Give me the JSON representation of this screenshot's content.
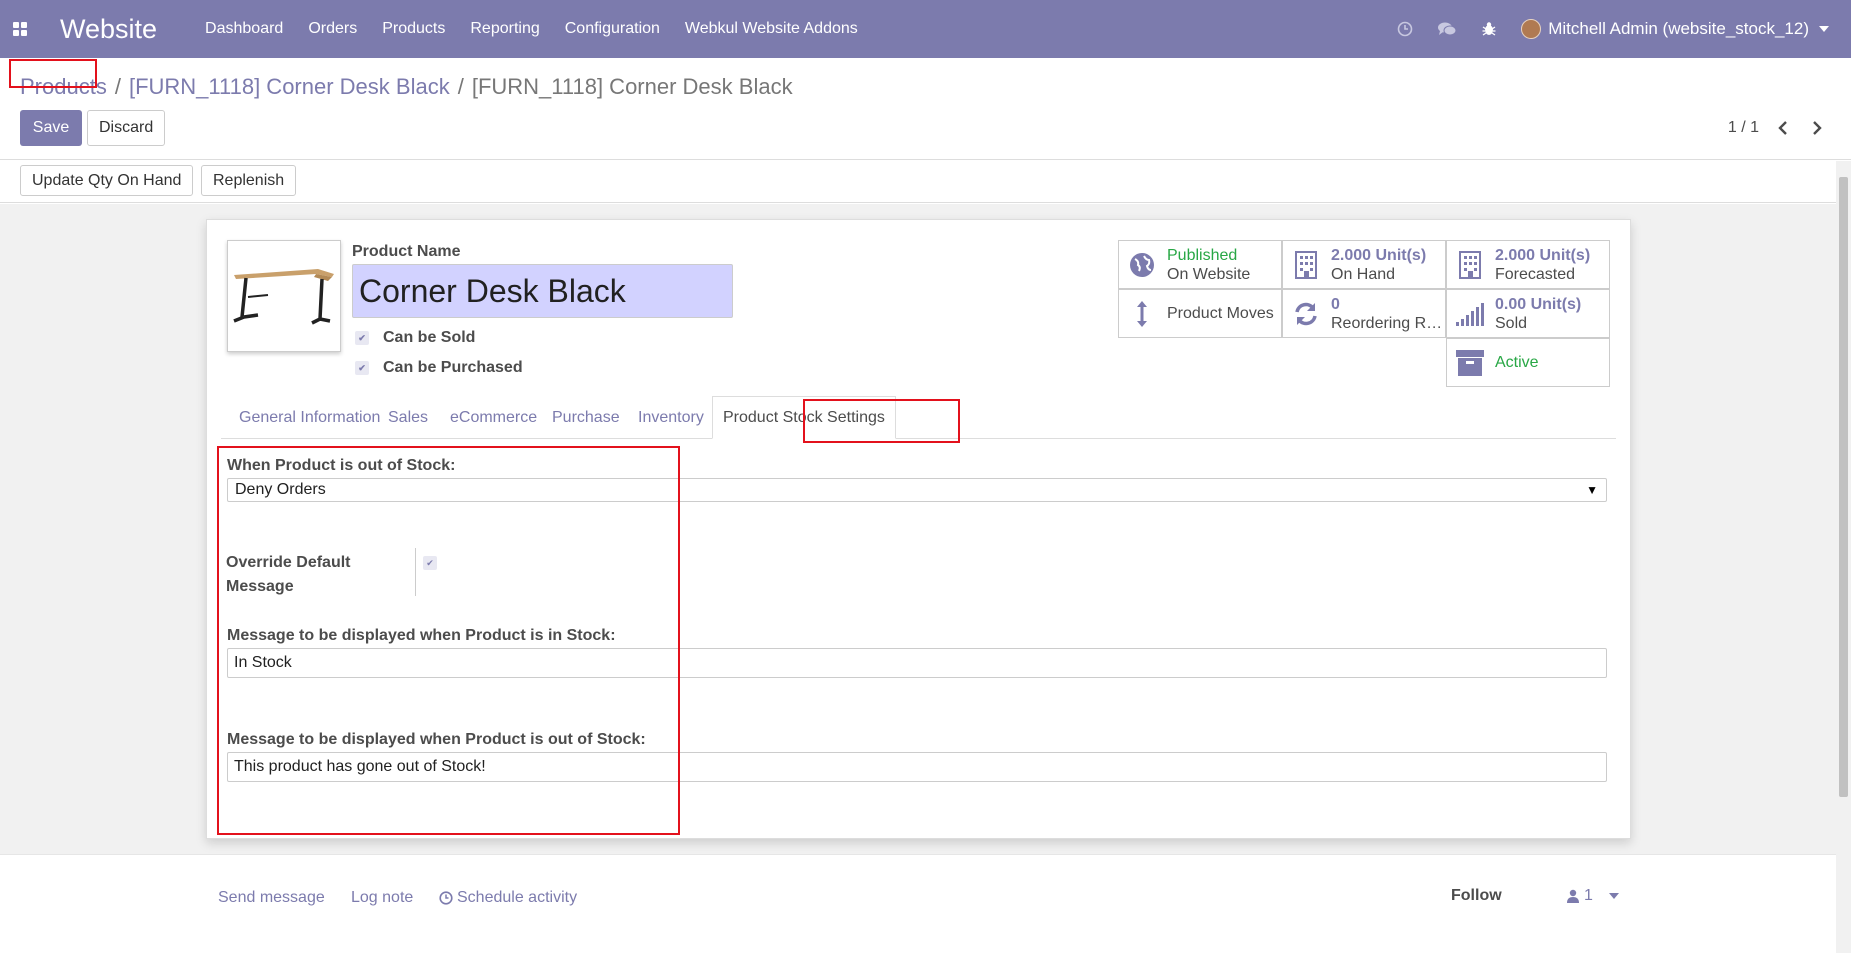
{
  "navbar": {
    "brand": "Website",
    "menu": [
      "Dashboard",
      "Orders",
      "Products",
      "Reporting",
      "Configuration",
      "Webkul Website Addons"
    ],
    "icons": [
      "clock-icon",
      "chat-icon",
      "bug-icon"
    ],
    "user": "Mitchell Admin (website_stock_12)",
    "bg_color": "#7c7bad"
  },
  "control_panel": {
    "breadcrumb": [
      "Products",
      "[FURN_1118] Corner Desk Black",
      "[FURN_1118] Corner Desk Black"
    ],
    "save_label": "Save",
    "discard_label": "Discard",
    "pager": "1 / 1"
  },
  "statusbar": {
    "update_qty_label": "Update Qty On Hand",
    "replenish_label": "Replenish"
  },
  "product": {
    "name_label": "Product Name",
    "name": "Corner Desk Black",
    "can_be_sold_label": "Can be Sold",
    "can_be_sold": true,
    "can_be_purchased_label": "Can be Purchased",
    "can_be_purchased": true
  },
  "smart_buttons": {
    "published": {
      "value": "Published",
      "sub": "On Website",
      "icon": "globe-icon"
    },
    "on_hand": {
      "value": "2.000 Unit(s)",
      "sub": "On Hand",
      "icon": "building-icon"
    },
    "forecasted": {
      "value": "2.000 Unit(s)",
      "sub": "Forecasted",
      "icon": "building-icon"
    },
    "product_moves": {
      "label": "Product Moves",
      "icon": "up-down-arrow-icon"
    },
    "reordering": {
      "value": "0",
      "sub": "Reordering Rules",
      "icon": "refresh-icon"
    },
    "sold": {
      "value": "0.00 Unit(s)",
      "sub": "Sold",
      "icon": "signal-icon"
    },
    "active": {
      "label": "Active",
      "icon": "archive-icon"
    }
  },
  "tabs": [
    "General Information",
    "Sales",
    "eCommerce",
    "Purchase",
    "Inventory",
    "Product Stock Settings"
  ],
  "active_tab": "Product Stock Settings",
  "stock_settings": {
    "out_of_stock_label": "When Product is out of Stock:",
    "out_of_stock_value": "Deny Orders",
    "override_label_line1": "Override Default",
    "override_label_line2": "Message",
    "override_checked": true,
    "in_stock_msg_label": "Message to be displayed when Product is in Stock:",
    "in_stock_msg": "In Stock",
    "out_stock_msg_label": "Message to be displayed when Product is out of Stock:",
    "out_stock_msg": "This product has gone out of Stock!"
  },
  "chatter": {
    "send_message": "Send message",
    "log_note": "Log note",
    "schedule_activity": "Schedule activity",
    "follow": "Follow",
    "followers_count": "1"
  },
  "colors": {
    "accent": "#7c7bad",
    "highlight": "#e3111c",
    "success": "#28a745"
  }
}
